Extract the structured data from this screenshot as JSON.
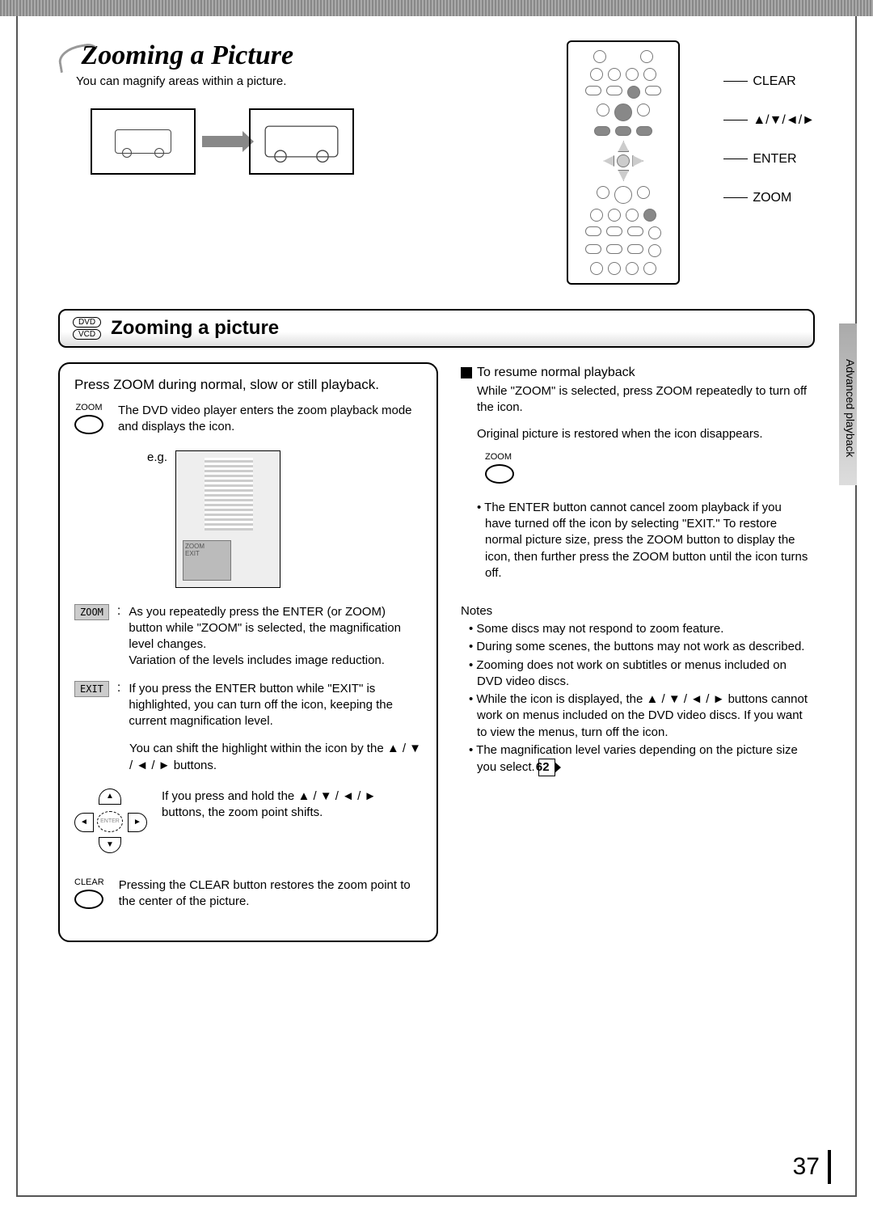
{
  "header": {
    "title": "Zooming a Picture",
    "subtitle": "You can magnify areas within a picture."
  },
  "remote": {
    "callouts": [
      "CLEAR",
      "▲/▼/◄/►",
      "ENTER",
      "ZOOM"
    ]
  },
  "section": {
    "badges": [
      "DVD",
      "VCD"
    ],
    "title": "Zooming a picture"
  },
  "left": {
    "intro": "Press ZOOM during normal, slow or still playback.",
    "zoom_btn_label": "ZOOM",
    "zoom_desc": "The DVD video player enters the zoom playback mode and displays the icon.",
    "eg_label": "e.g.",
    "zoom_tag": "ZOOM",
    "zoom_tag_desc": "As you repeatedly press the ENTER (or ZOOM) button while \"ZOOM\" is selected, the magnification level changes.\nVariation of the levels includes image reduction.",
    "exit_tag": "EXIT",
    "exit_tag_desc": "If you press the ENTER button while \"EXIT\" is highlighted, you can turn off the icon, keeping the current magnification level.",
    "shift_desc": "You can shift the highlight within the icon by the ▲ / ▼ / ◄ / ► buttons.",
    "hold_desc": "If you press and hold the ▲ / ▼ / ◄ / ► buttons, the zoom point shifts.",
    "clear_btn_label": "CLEAR",
    "clear_desc": "Pressing the CLEAR button restores the zoom point to the center of the picture.",
    "arrows": {
      "u": "▲",
      "d": "▼",
      "l": "◄",
      "r": "►",
      "c": "ENTER"
    }
  },
  "right": {
    "resume_h": "To resume normal playback",
    "resume_p1": "While \"ZOOM\" is selected, press ZOOM repeatedly to turn off the icon.",
    "resume_p2": "Original picture is restored when the icon disappears.",
    "zoom_btn_label": "ZOOM",
    "enter_note": "The ENTER button cannot cancel zoom playback if you have turned off the icon by selecting \"EXIT.\" To restore normal picture size, press the ZOOM button to display the icon, then further press the ZOOM button until the icon turns off.",
    "notes_h": "Notes",
    "notes": [
      "Some discs may not respond to zoom feature.",
      "During some scenes, the buttons may not work as described.",
      "Zooming does not work on subtitles or menus included on DVD video discs.",
      "While the icon is displayed, the ▲ / ▼ / ◄ / ► buttons cannot work on menus included on the DVD video discs. If you want to view the menus, turn off the icon.",
      "The magnification level varies depending on the picture size you select."
    ],
    "page_ref": "62"
  },
  "side_tab": "Advanced playback",
  "page_number": "37"
}
